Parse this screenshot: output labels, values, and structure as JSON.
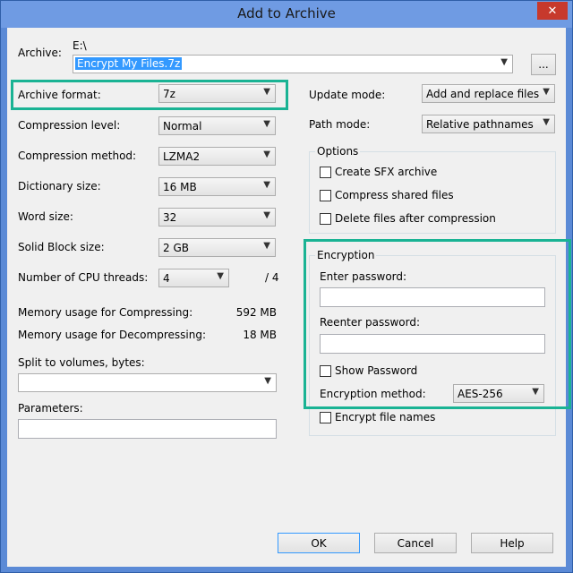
{
  "window": {
    "title": "Add to Archive",
    "close_symbol": "✕"
  },
  "archive": {
    "label": "Archive:",
    "path": "E:\\",
    "filename": "Encrypt My Files.7z",
    "browse_label": "..."
  },
  "left": {
    "archive_format": {
      "label": "Archive format:",
      "value": "7z"
    },
    "compression_level": {
      "label": "Compression level:",
      "value": "Normal"
    },
    "compression_method": {
      "label": "Compression method:",
      "value": "LZMA2"
    },
    "dictionary_size": {
      "label": "Dictionary size:",
      "value": "16 MB"
    },
    "word_size": {
      "label": "Word size:",
      "value": "32"
    },
    "solid_block_size": {
      "label": "Solid Block size:",
      "value": "2 GB"
    },
    "cpu_threads": {
      "label": "Number of CPU threads:",
      "value": "4",
      "max": "/ 4"
    },
    "memory_compress": {
      "label": "Memory usage for Compressing:",
      "value": "592 MB"
    },
    "memory_decompress": {
      "label": "Memory usage for Decompressing:",
      "value": "18 MB"
    },
    "split_volumes": {
      "label": "Split to volumes, bytes:",
      "value": ""
    },
    "parameters": {
      "label": "Parameters:",
      "value": ""
    }
  },
  "right": {
    "update_mode": {
      "label": "Update mode:",
      "value": "Add and replace files"
    },
    "path_mode": {
      "label": "Path mode:",
      "value": "Relative pathnames"
    },
    "options": {
      "title": "Options",
      "create_sfx": "Create SFX archive",
      "compress_shared": "Compress shared files",
      "delete_after": "Delete files after compression"
    },
    "encryption": {
      "title": "Encryption",
      "enter_password": "Enter password:",
      "reenter_password": "Reenter password:",
      "show_password": "Show Password",
      "method_label": "Encryption method:",
      "method_value": "AES-256",
      "encrypt_names": "Encrypt file names"
    }
  },
  "buttons": {
    "ok": "OK",
    "cancel": "Cancel",
    "help": "Help"
  },
  "colors": {
    "highlight": "#1ab394",
    "selection": "#3399ff",
    "titlebar": "#6f9be3"
  }
}
